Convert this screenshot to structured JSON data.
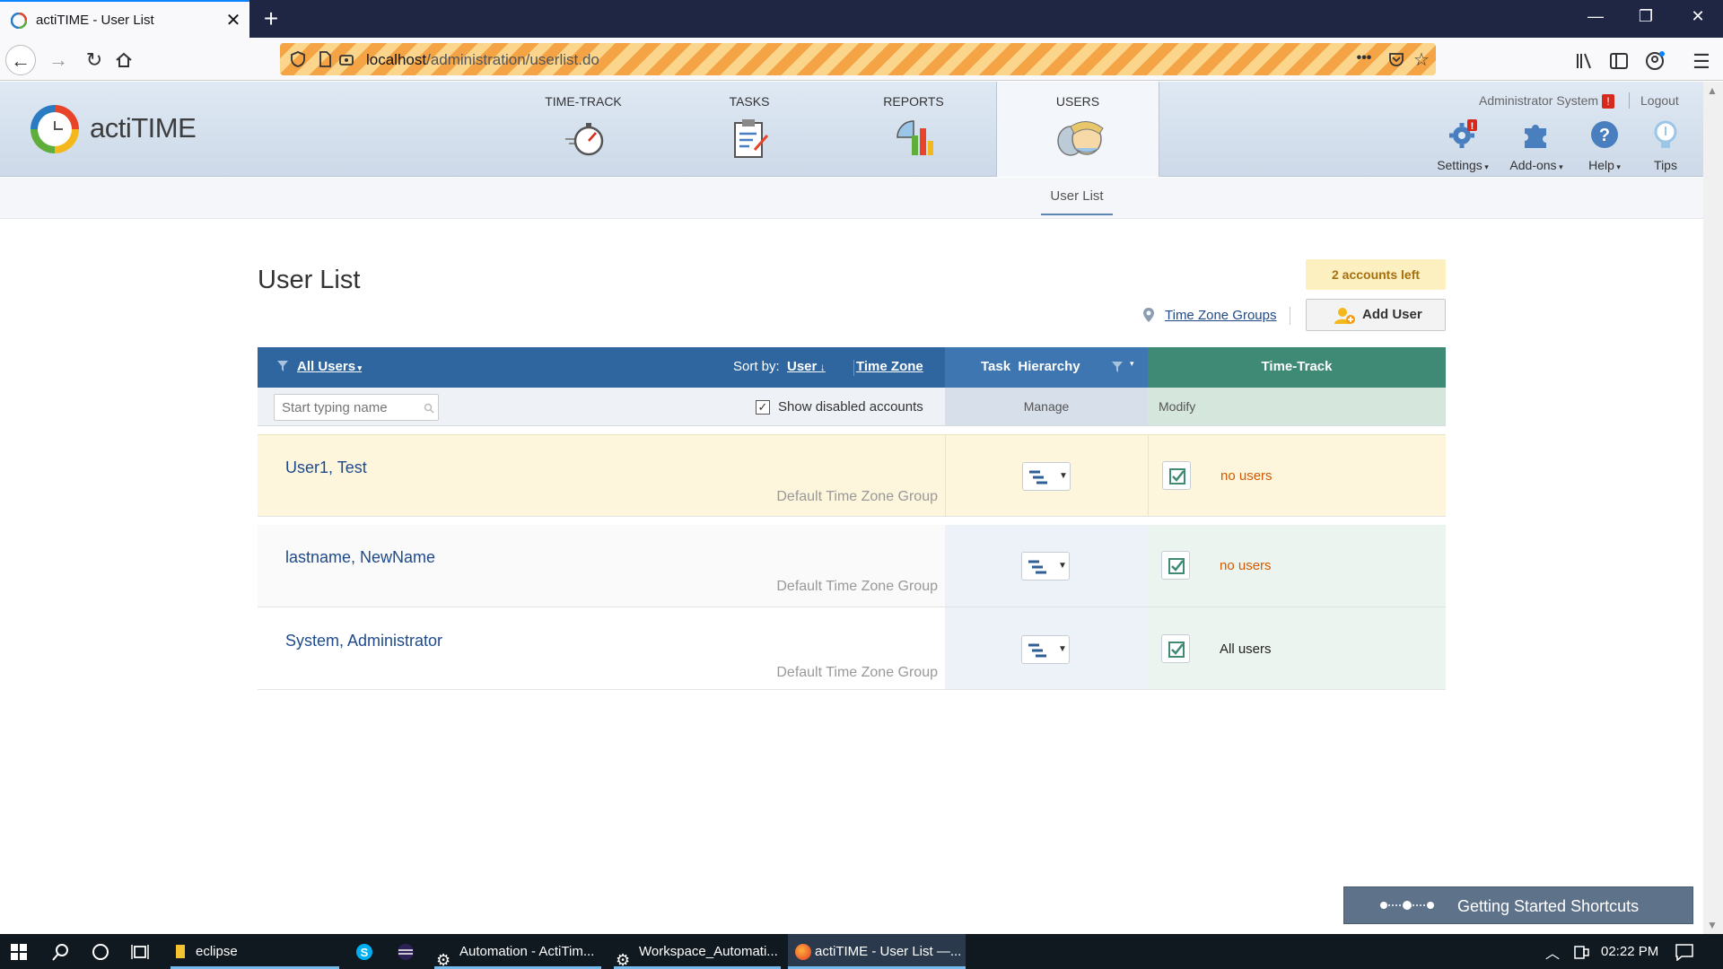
{
  "browser": {
    "tab_title": "actiTIME - User List",
    "url_host": "localhost",
    "url_path": "/administration/userlist.do"
  },
  "app": {
    "logo_text": "actiTIME",
    "modules": [
      {
        "label": "TIME-TRACK"
      },
      {
        "label": "TASKS"
      },
      {
        "label": "REPORTS"
      },
      {
        "label": "USERS"
      }
    ],
    "user_name": "Administrator System",
    "warning_badge": "!",
    "logout": "Logout",
    "tools": [
      {
        "label": "Settings"
      },
      {
        "label": "Add-ons"
      },
      {
        "label": "Help"
      },
      {
        "label": "Tips"
      }
    ],
    "subnav": "User List"
  },
  "page": {
    "title": "User List",
    "accounts_left": "2 accounts left",
    "tz_groups_link": "Time Zone Groups",
    "add_user": "Add User"
  },
  "table": {
    "filter_label": "All Users",
    "sort_by_label": "Sort by:",
    "sort_user": "User",
    "sort_tz": "Time Zone",
    "task_hierarchy": "Task  Hierarchy",
    "time_track": "Time-Track",
    "search_placeholder": "Start typing name",
    "show_disabled": "Show disabled accounts",
    "manage": "Manage",
    "modify": "Modify",
    "rows": [
      {
        "name": "User1, Test",
        "tz_group": "Default Time Zone Group",
        "tt_value": "no users"
      },
      {
        "name": "lastname, NewName",
        "tz_group": "Default Time Zone Group",
        "tt_value": "no users"
      },
      {
        "name": "System, Administrator",
        "tz_group": "Default Time Zone Group",
        "tt_value": "All users"
      }
    ]
  },
  "getting_started": "Getting Started Shortcuts",
  "taskbar": {
    "items": [
      {
        "label": "eclipse"
      },
      {
        "label": "Automation - ActiTim..."
      },
      {
        "label": "Workspace_Automati..."
      },
      {
        "label": "actiTIME - User List —..."
      }
    ],
    "time": "02:22 PM"
  },
  "colors": {
    "header_blue": "#2f66a0",
    "time_track_green": "#3e8a74",
    "row1_bg": "#fdf6dc",
    "no_users": "#d35a00"
  }
}
